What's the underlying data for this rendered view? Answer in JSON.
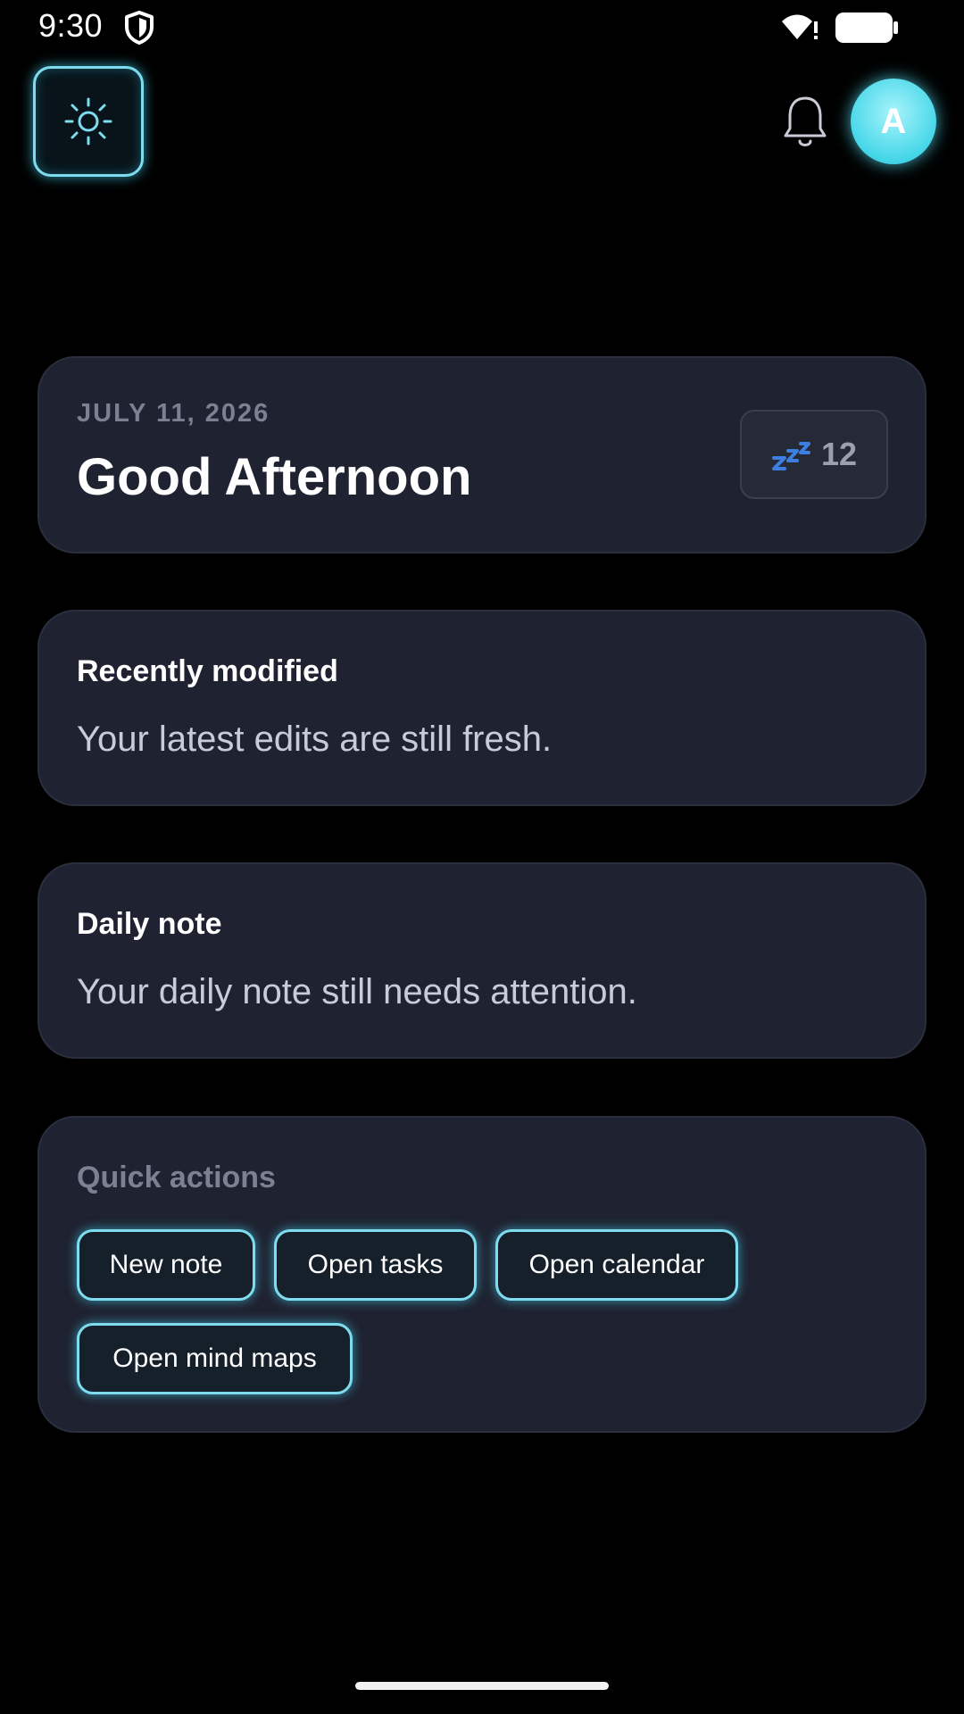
{
  "status_bar": {
    "time": "9:30"
  },
  "header": {
    "theme_toggle_icon": "sun-icon",
    "notification_icon": "bell-icon",
    "avatar_initial": "A",
    "accent_color": "#7fdcef"
  },
  "greeting_card": {
    "date": "JULY 11, 2026",
    "title": "Good Afternoon",
    "badge_icon": "zzz-icon",
    "badge_count": "12"
  },
  "recent_card": {
    "title": "Recently modified",
    "body": "Your latest edits are still fresh."
  },
  "daily_card": {
    "title": "Daily note",
    "body": "Your daily note still needs attention."
  },
  "quick_actions": {
    "title": "Quick actions",
    "actions": [
      {
        "label": "New note"
      },
      {
        "label": "Open tasks"
      },
      {
        "label": "Open calendar"
      },
      {
        "label": "Open mind maps"
      }
    ]
  }
}
